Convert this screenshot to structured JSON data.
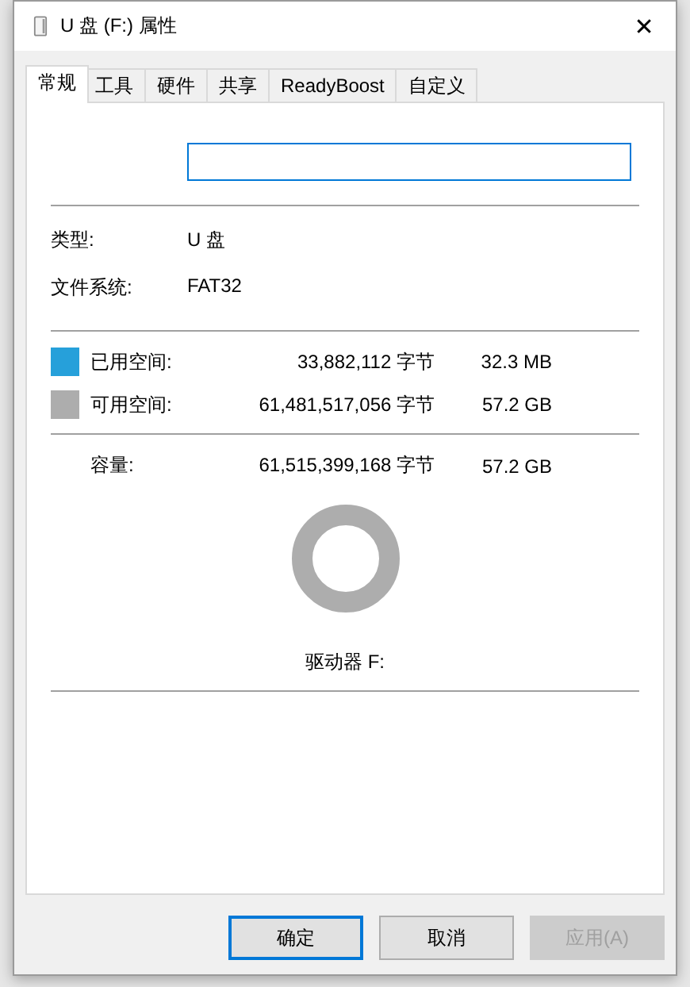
{
  "window": {
    "title": "U 盘 (F:) 属性",
    "close": "✕"
  },
  "tabs": [
    {
      "label": "常规",
      "selected": true
    },
    {
      "label": "工具",
      "selected": false
    },
    {
      "label": "硬件",
      "selected": false
    },
    {
      "label": "共享",
      "selected": false
    },
    {
      "label": "ReadyBoost",
      "selected": false
    },
    {
      "label": "自定义",
      "selected": false
    }
  ],
  "name_field": {
    "focused": true
  },
  "info": [
    {
      "label": "类型:",
      "value": "U 盘"
    },
    {
      "label": "文件系统:",
      "value": "FAT32"
    }
  ],
  "space": [
    {
      "label": "已用空间:",
      "bytes": "33,882,112 字节",
      "size": "32.3 MB",
      "color": "#26a0da"
    },
    {
      "label": "可用空间:",
      "bytes": "61,481,517,056 字节",
      "size": "57.2 GB",
      "color": "#adadad"
    }
  ],
  "capacity": {
    "label": "容量:",
    "bytes": "61,515,399,168 字节",
    "size": "57.2 GB"
  },
  "drive_label": "驱动器 F:",
  "buttons": [
    {
      "label": "确定",
      "default": true,
      "disabled": false
    },
    {
      "label": "取消",
      "default": false,
      "disabled": false
    },
    {
      "label": "应用(A)",
      "default": false,
      "disabled": true
    }
  ]
}
